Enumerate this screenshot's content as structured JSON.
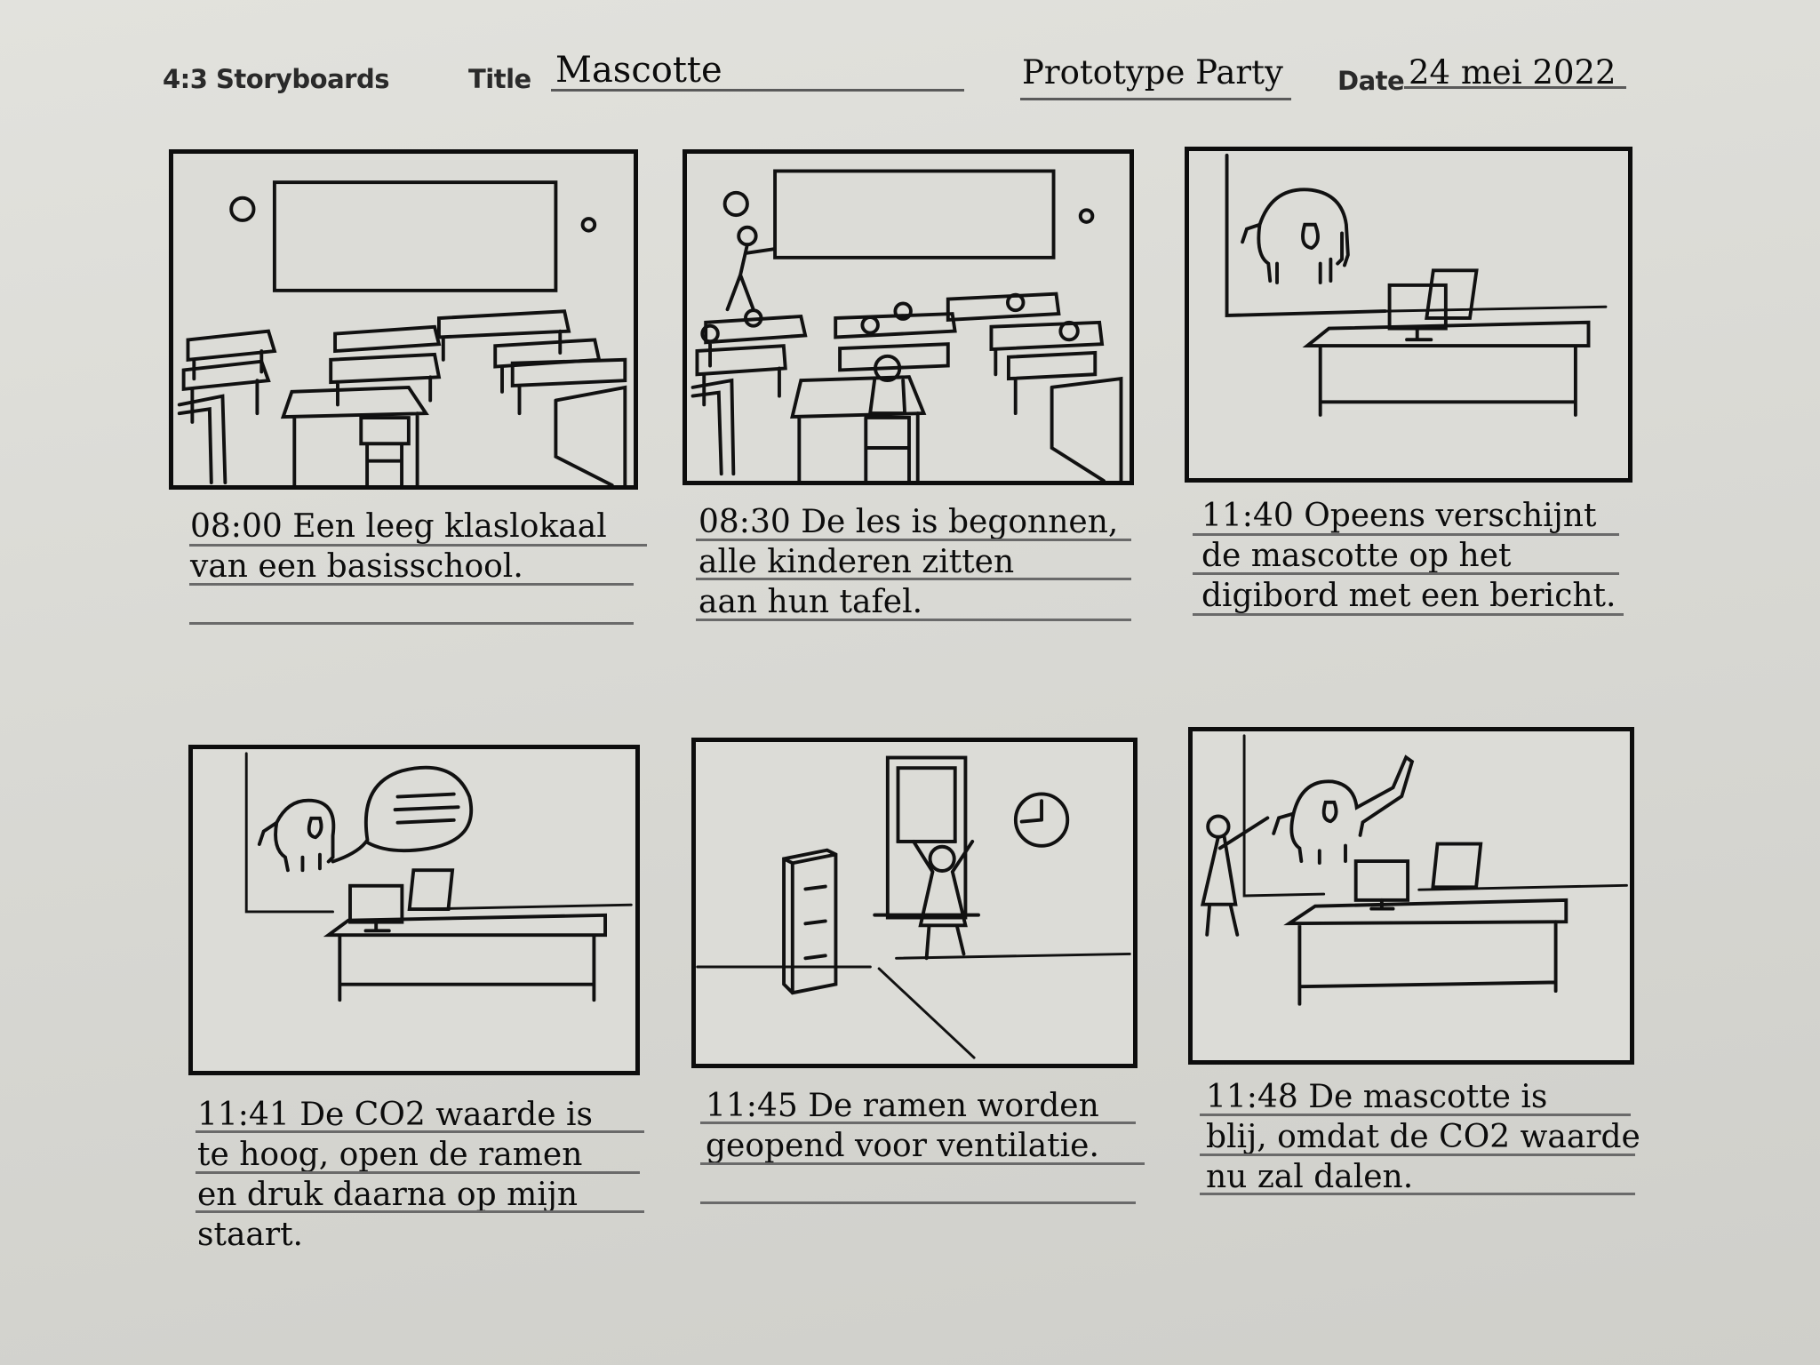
{
  "header": {
    "form_label": "4:3 Storyboards",
    "title_label": "Title",
    "title_value": "Mascotte",
    "project_value": "Prototype Party",
    "date_label": "Date",
    "date_value": "24 mei 2022"
  },
  "panels": [
    {
      "time": "08:00",
      "lines": [
        "08:00 Een leeg klaslokaal",
        "van een basisschool."
      ]
    },
    {
      "time": "08:30",
      "lines": [
        "08:30 De les is begonnen,",
        "alle kinderen zitten",
        "aan hun tafel."
      ]
    },
    {
      "time": "11:40",
      "lines": [
        "11:40 Opeens verschijnt",
        "de mascotte op het",
        "digibord met een bericht."
      ]
    },
    {
      "time": "11:41",
      "lines": [
        "11:41 De CO2 waarde is",
        "te hoog, open de ramen",
        "en druk daarna op mijn",
        "staart."
      ]
    },
    {
      "time": "11:45",
      "lines": [
        "11:45 De ramen worden",
        "geopend voor ventilatie."
      ]
    },
    {
      "time": "11:48",
      "lines": [
        "11:48 De mascotte is",
        "blij, omdat de CO2 waarde",
        "nu zal dalen."
      ]
    }
  ]
}
